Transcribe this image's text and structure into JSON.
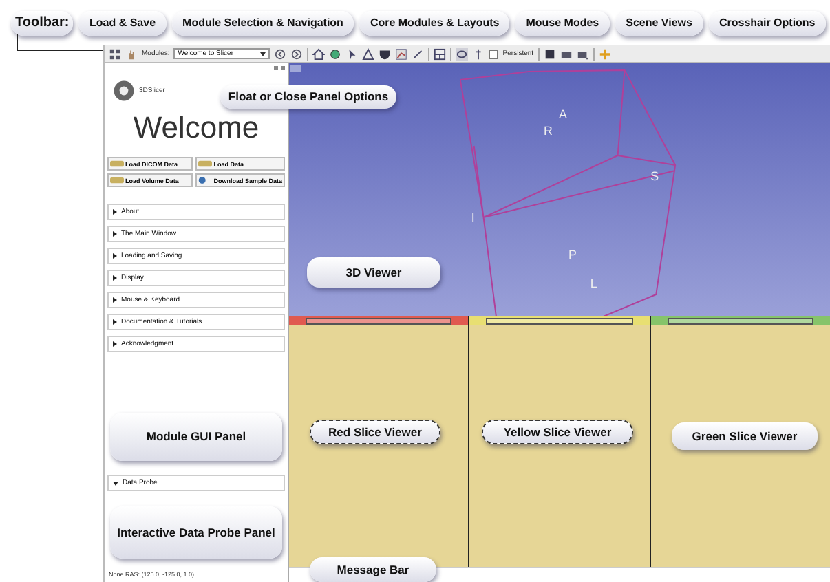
{
  "callouts_top": [
    "Toolbar:",
    "Load & Save",
    "Module Selection & Navigation",
    "Core Modules & Layouts",
    "Mouse Modes",
    "Scene Views",
    "Crosshair Options"
  ],
  "toolbar": {
    "modules_label": "Modules:",
    "module_value": "Welcome to Slicer",
    "persistent_label": "Persistent",
    "persistent_checked": false
  },
  "panel": {
    "logo_text": "3DSlicer",
    "title": "Welcome",
    "buttons": [
      "Load DICOM Data",
      "Load Data",
      "Load Volume Data",
      "Download Sample Data"
    ],
    "sections": [
      {
        "label": "About",
        "expanded": false
      },
      {
        "label": "The Main Window",
        "expanded": false
      },
      {
        "label": "Loading and Saving",
        "expanded": false
      },
      {
        "label": "Display",
        "expanded": false
      },
      {
        "label": "Mouse & Keyboard",
        "expanded": false
      },
      {
        "label": "Documentation & Tutorials",
        "expanded": false
      },
      {
        "label": "Acknowledgment",
        "expanded": false
      }
    ],
    "data_probe": "Data Probe",
    "status": "None RAS: (125.0, -125.0, 1.0)"
  },
  "viewer3d": {
    "labels": [
      "A",
      "R",
      "S",
      "I",
      "P",
      "L"
    ]
  },
  "slices": [
    {
      "color": "#e05a50"
    },
    {
      "color": "#e8df72"
    },
    {
      "color": "#86c46a"
    }
  ],
  "callouts_overlay": [
    "Float or Close Panel Options",
    "3D Viewer",
    "Module GUI Panel",
    "Interactive Data Probe Panel",
    "Red Slice Viewer",
    "Yellow Slice Viewer",
    "Green Slice Viewer",
    "Message  Bar"
  ]
}
